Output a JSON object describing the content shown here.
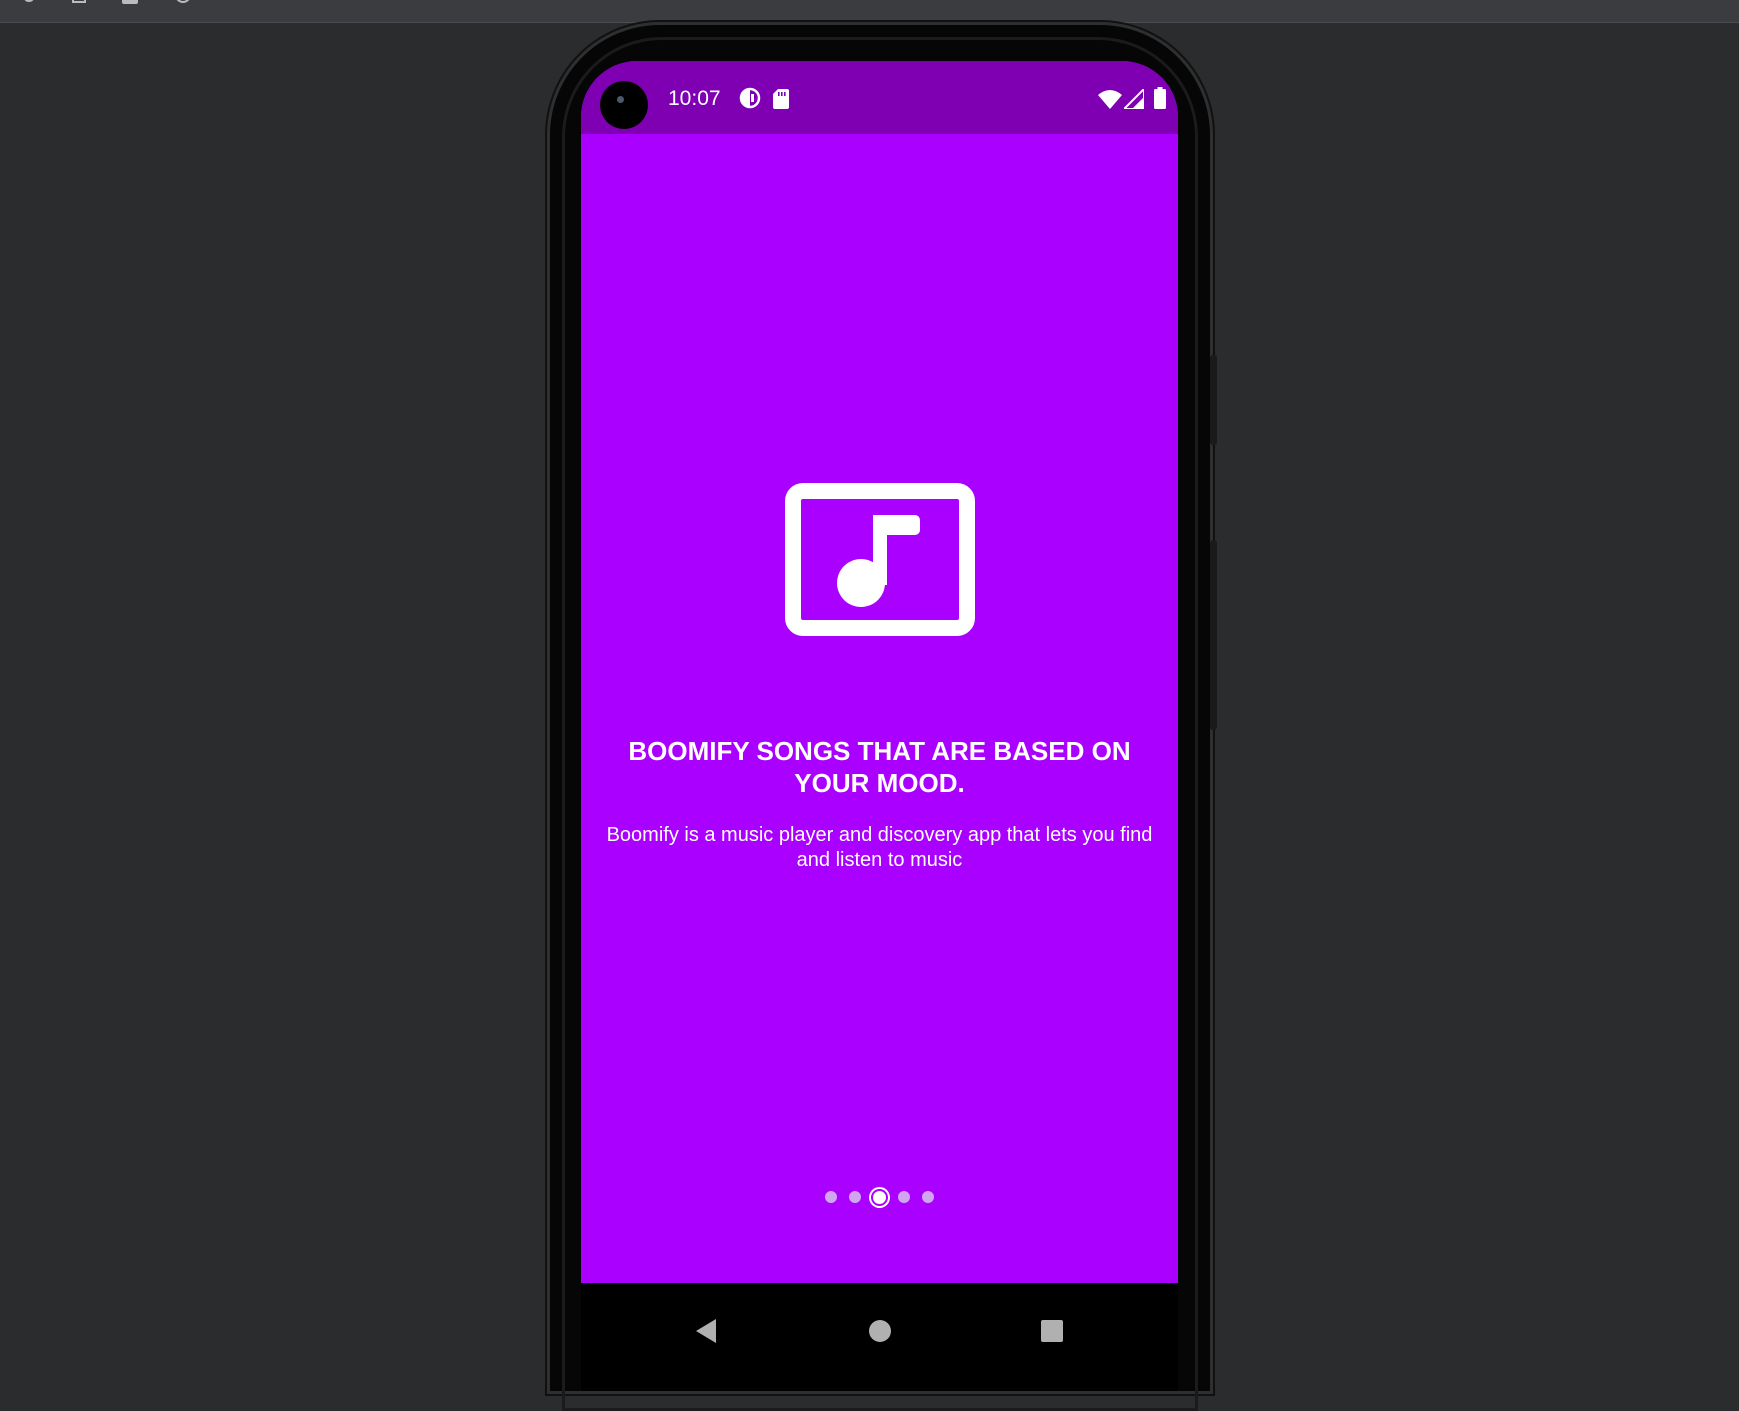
{
  "colors": {
    "screen_bg": "#aa00ff",
    "status_bar_bg": "#7f00b2",
    "text": "#ffffff",
    "dot_inactive": "#d0a6f0",
    "nav_bar_bg": "#000000"
  },
  "toolbar": {
    "icons": [
      "run-icon",
      "stop-icon",
      "camera-icon",
      "rotate-icon",
      "more-icon"
    ]
  },
  "status_bar": {
    "time": "10:07",
    "left_icons": [
      "data-saver-icon",
      "sd-card-icon"
    ],
    "right_icons": [
      "wifi-icon",
      "cell-signal-icon",
      "battery-icon"
    ]
  },
  "onboarding": {
    "icon": "music-note-icon",
    "headline": "BOOMIFY SONGS THAT ARE BASED ON YOUR MOOD.",
    "subtitle": "Boomify is a music player and discovery app that lets you find and listen to music",
    "page_count": 5,
    "current_page": 3
  },
  "navigation_bar": {
    "buttons": [
      "back-icon",
      "home-icon",
      "recents-icon"
    ]
  }
}
